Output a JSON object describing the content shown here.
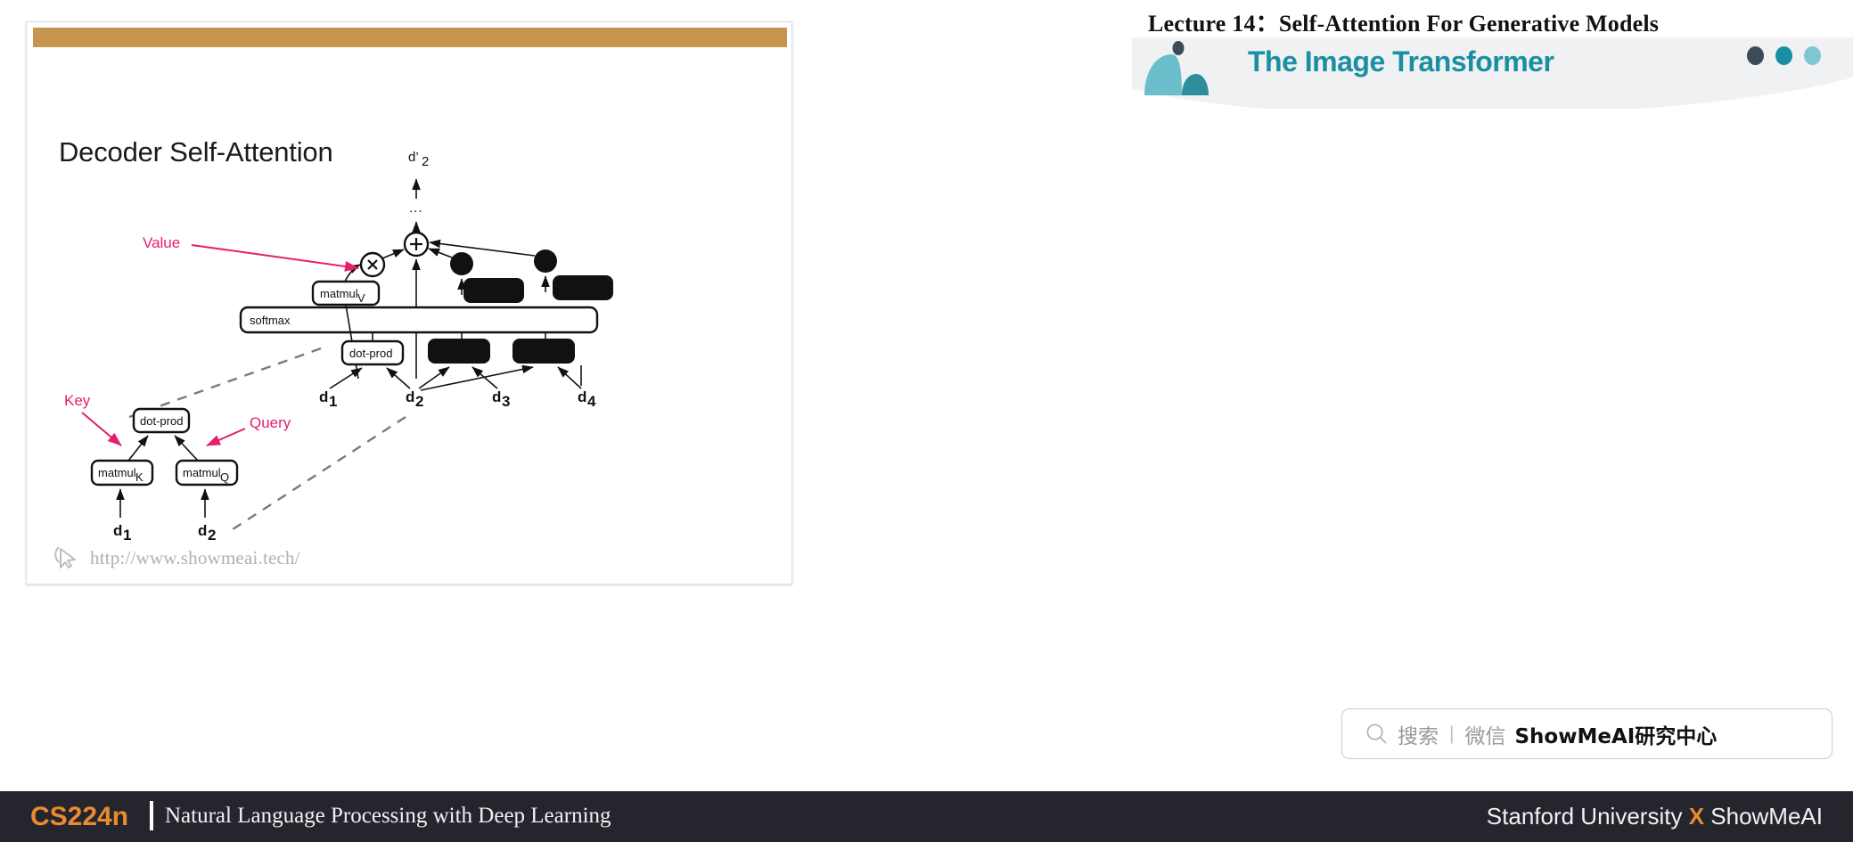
{
  "header": {
    "lecture_title": "Lecture 14：Self-Attention For Generative Models",
    "brand_name": "The Image Transformer",
    "dot_colors": [
      "#3d4a58",
      "#1a8fa3",
      "#7fc6d4"
    ],
    "logo_colors": {
      "light": "#6dbecd",
      "dark": "#2f8e9e",
      "pin": "#3d4a58"
    }
  },
  "slide": {
    "accent_bar_color": "#c8954f",
    "title": "Decoder Self-Attention",
    "url": "http://www.showmeai.tech/",
    "cursor_icon": "mouse-pointer-icon",
    "annotations": {
      "value": "Value",
      "key": "Key",
      "query": "Query"
    },
    "output_label": "d'",
    "output_subscript": "2",
    "ellipsis": "...",
    "nodes": {
      "plus": "+",
      "times": "×"
    },
    "boxes": {
      "matmul_v": "matmul",
      "matmul_v_sub": "V",
      "softmax": "softmax",
      "dot_prod": "dot-prod",
      "matmul_k": "matmul",
      "matmul_k_sub": "K",
      "matmul_q": "matmul",
      "matmul_q_sub": "Q"
    },
    "inputs_top": [
      {
        "label": "d",
        "sub": "1"
      },
      {
        "label": "d",
        "sub": "2"
      },
      {
        "label": "d",
        "sub": "3"
      },
      {
        "label": "d",
        "sub": "4"
      }
    ],
    "inputs_detail": [
      {
        "label": "d",
        "sub": "1"
      },
      {
        "label": "d",
        "sub": "2"
      }
    ],
    "annotation_color": "#e61e6e"
  },
  "search": {
    "placeholder_cn": "搜索",
    "separator": "|",
    "channel": "微信",
    "brand": "ShowMeAI研究中心",
    "icon": "search-icon"
  },
  "footer": {
    "course_code": "CS224n",
    "course_name": "Natural Language Processing with Deep Learning",
    "right_left": "Stanford University",
    "right_x": "X",
    "right_right": "ShowMeAI",
    "bg_color": "#24252d",
    "accent_color": "#e98b2e"
  }
}
